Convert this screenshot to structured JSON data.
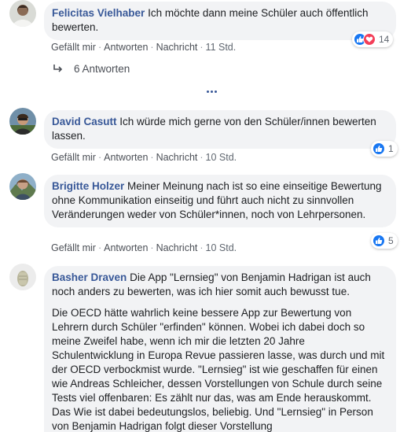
{
  "comments": [
    {
      "author": "Felicitas Vielhaber",
      "text": "Ich möchte dann meine Schüler auch öffentlich bewerten.",
      "actions": {
        "like": "Gefällt mir",
        "reply": "Antworten",
        "message": "Nachricht",
        "time": "11 Std."
      },
      "reactions": {
        "icons": [
          "like-icon",
          "love-icon"
        ],
        "count": "14"
      },
      "replies_label": "6 Antworten"
    },
    {
      "author": "David Casutt",
      "text": "Ich würde mich gerne von den Schüler/innen bewerten lassen.",
      "actions": {
        "like": "Gefällt mir",
        "reply": "Antworten",
        "message": "Nachricht",
        "time": "10 Std."
      },
      "reactions": {
        "icons": [
          "like-icon"
        ],
        "count": "1"
      }
    },
    {
      "author": "Brigitte Holzer",
      "text": "Meiner Meinung nach ist so eine einseitige Bewertung ohne Kommunikation einseitig und führt auch nicht zu sinnvollen Veränderungen weder von Schüler*innen, noch von Lehrpersonen.",
      "actions": {
        "like": "Gefällt mir",
        "reply": "Antworten",
        "message": "Nachricht",
        "time": "10 Std."
      },
      "reactions": {
        "icons": [
          "like-icon"
        ],
        "count": "5"
      }
    },
    {
      "author": "Basher Draven",
      "text": "Die App \"Lernsieg\" von Benjamin Hadrigan ist auch noch anders zu bewerten, was ich hier somit auch bewusst tue.",
      "text2": "Die OECD hätte wahrlich keine bessere App zur Bewertung von Lehrern durch Schüler \"erfinden\" können. Wobei ich dabei doch so meine Zweifel habe, wenn ich mir die letzten 20 Jahre Schulentwicklung in Europa Revue passieren lasse, was durch und mit der OECD verbockmist wurde. \"Lernsieg\" ist wie geschaffen für einen wie Andreas Schleicher, dessen Vorstellungen von Schule durch seine Tests viel offenbaren: Es zählt nur das, was am Ende herauskommt. Das Wie ist dabei bedeutungslos, beliebig. Und \"Lernsieg\" in Person von Benjamin Hadrigan folgt dieser Vorstellung"
    }
  ],
  "colors": {
    "author": "#385898",
    "bubble": "#f2f3f5",
    "like": "#1877f2",
    "love": "#f33e58"
  }
}
